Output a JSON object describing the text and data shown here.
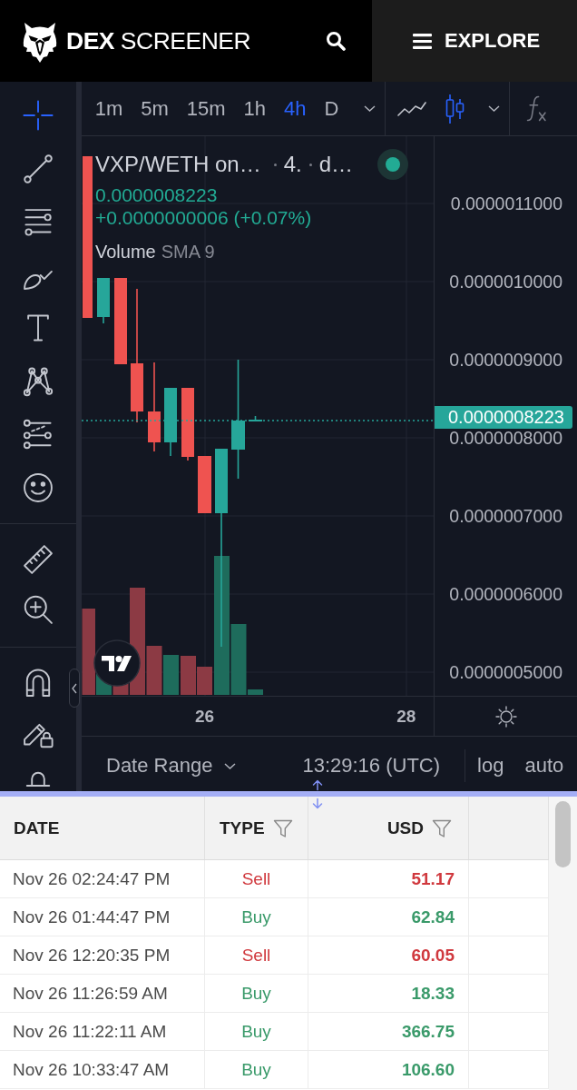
{
  "header": {
    "brand": "**DEX** SCREENER",
    "explore": "EXPLORE"
  },
  "chart": {
    "intervals": [
      {
        "label": "1m",
        "selected": false
      },
      {
        "label": "5m",
        "selected": false
      },
      {
        "label": "15m",
        "selected": false
      },
      {
        "label": "1h",
        "selected": false
      },
      {
        "label": "4h",
        "selected": true
      },
      {
        "label": "D",
        "selected": false
      }
    ],
    "chart_styles": [
      {
        "selected": false
      },
      {
        "selected": true
      }
    ],
    "drawing_tools": [
      [
        {
          "selected": true
        },
        {
          "selected": false
        },
        {
          "selected": false
        },
        {
          "selected": false
        },
        {
          "selected": false
        },
        {
          "selected": false
        },
        {
          "selected": false
        },
        {
          "selected": false
        }
      ],
      [
        {
          "selected": false
        },
        {
          "selected": false
        }
      ],
      [
        {
          "selected": false
        },
        {
          "selected": false
        },
        {
          "selected": false
        }
      ]
    ],
    "legend": {
      "symbol": "VXP/WETH on…",
      "interval": "4.",
      "exchange": "d…",
      "price": "0.0000008223",
      "change": "+0.0000000006 (+0.07%)",
      "indicator": "Volume",
      "indicator_settings": "SMA 9"
    },
    "price_axis": [
      "0.0000011000",
      "0.0000010000",
      "0.0000009000",
      "0.0000008000",
      "0.0000007000",
      "0.0000006000",
      "0.0000005000"
    ],
    "last_price_tag": "0.0000008223",
    "time_axis": [
      "26",
      "28"
    ],
    "bottom_bar": {
      "date_range": "Date Range",
      "clock": "13:29:16 (UTC)",
      "log": "log",
      "auto": "auto"
    }
  },
  "trades": {
    "columns": [
      {
        "label": "DATE",
        "filter": false
      },
      {
        "label": "TYPE",
        "filter": true
      },
      {
        "label": "USD",
        "filter": true
      }
    ],
    "rows": [
      {
        "kind": "sell",
        "date": "Nov 26 02:24:47 PM",
        "type": "Sell",
        "usd": "51.17"
      },
      {
        "kind": "buy",
        "date": "Nov 26 01:44:47 PM",
        "type": "Buy",
        "usd": "62.84"
      },
      {
        "kind": "sell",
        "date": "Nov 26 12:20:35 PM",
        "type": "Sell",
        "usd": "60.05"
      },
      {
        "kind": "buy",
        "date": "Nov 26 11:26:59 AM",
        "type": "Buy",
        "usd": "18.33"
      },
      {
        "kind": "buy",
        "date": "Nov 26 11:22:11 AM",
        "type": "Buy",
        "usd": "366.75"
      },
      {
        "kind": "buy",
        "date": "Nov 26 10:33:47 AM",
        "type": "Buy",
        "usd": "106.60"
      }
    ]
  }
}
